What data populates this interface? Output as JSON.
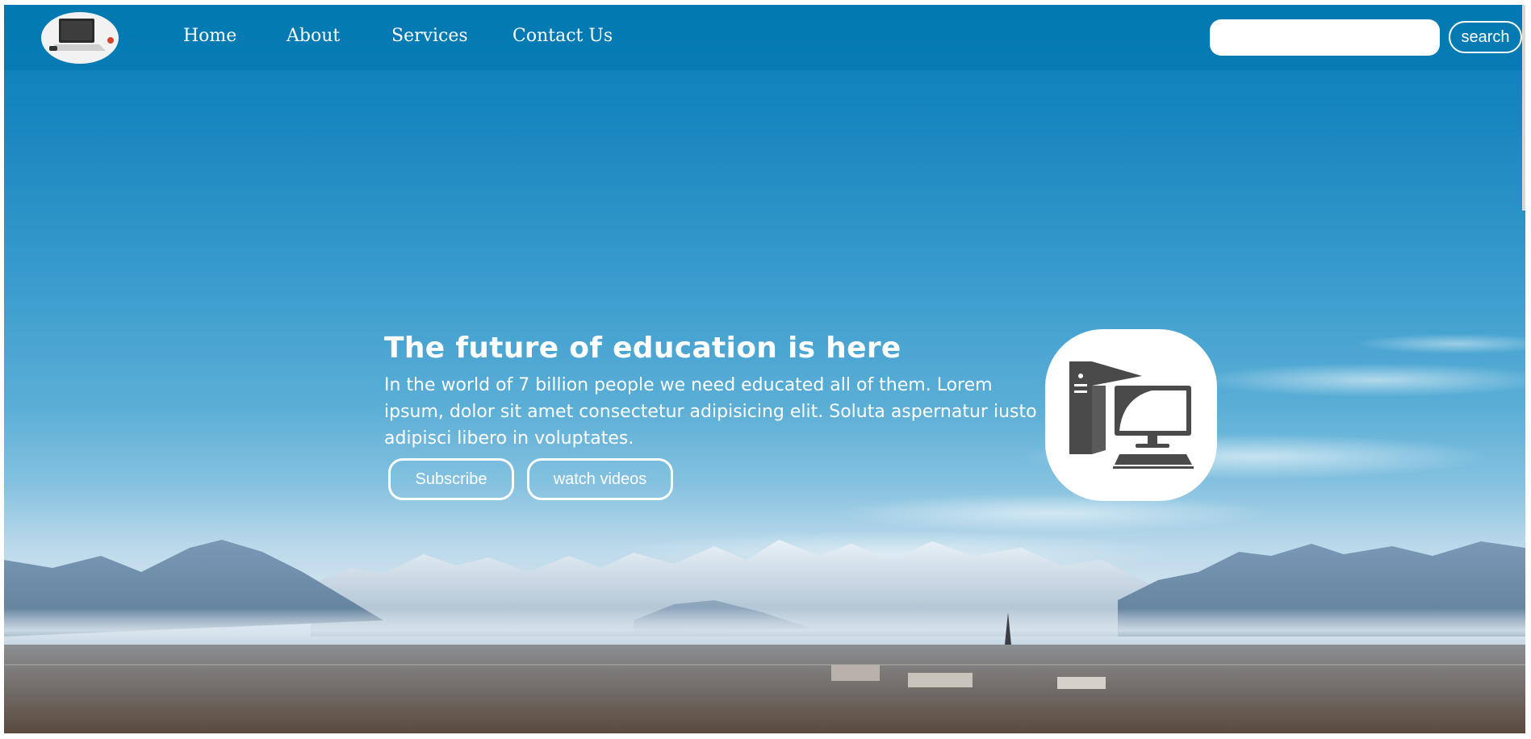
{
  "nav": {
    "links": [
      "Home",
      "About",
      "Services",
      "Contact Us"
    ]
  },
  "search": {
    "placeholder": "",
    "value": "",
    "button_label": "search"
  },
  "hero": {
    "title": "The future of education is here",
    "description": "In the world of 7 billion people we need educated all of them. Lorem ipsum, dolor sit amet consectetur adipisicing elit. Soluta aspernatur iusto adipisci libero in voluptates.",
    "subscribe_label": "Subscribe",
    "watch_label": "watch videos"
  },
  "icons": {
    "logo": "laptop-logo-icon",
    "badge": "desktop-computer-icon"
  },
  "colors": {
    "header": "#0a7ab5",
    "sky_top": "#067cb6",
    "sky_mid": "#5aaed6",
    "text": "#ffffff",
    "computer_icon": "#4a4a4a"
  }
}
